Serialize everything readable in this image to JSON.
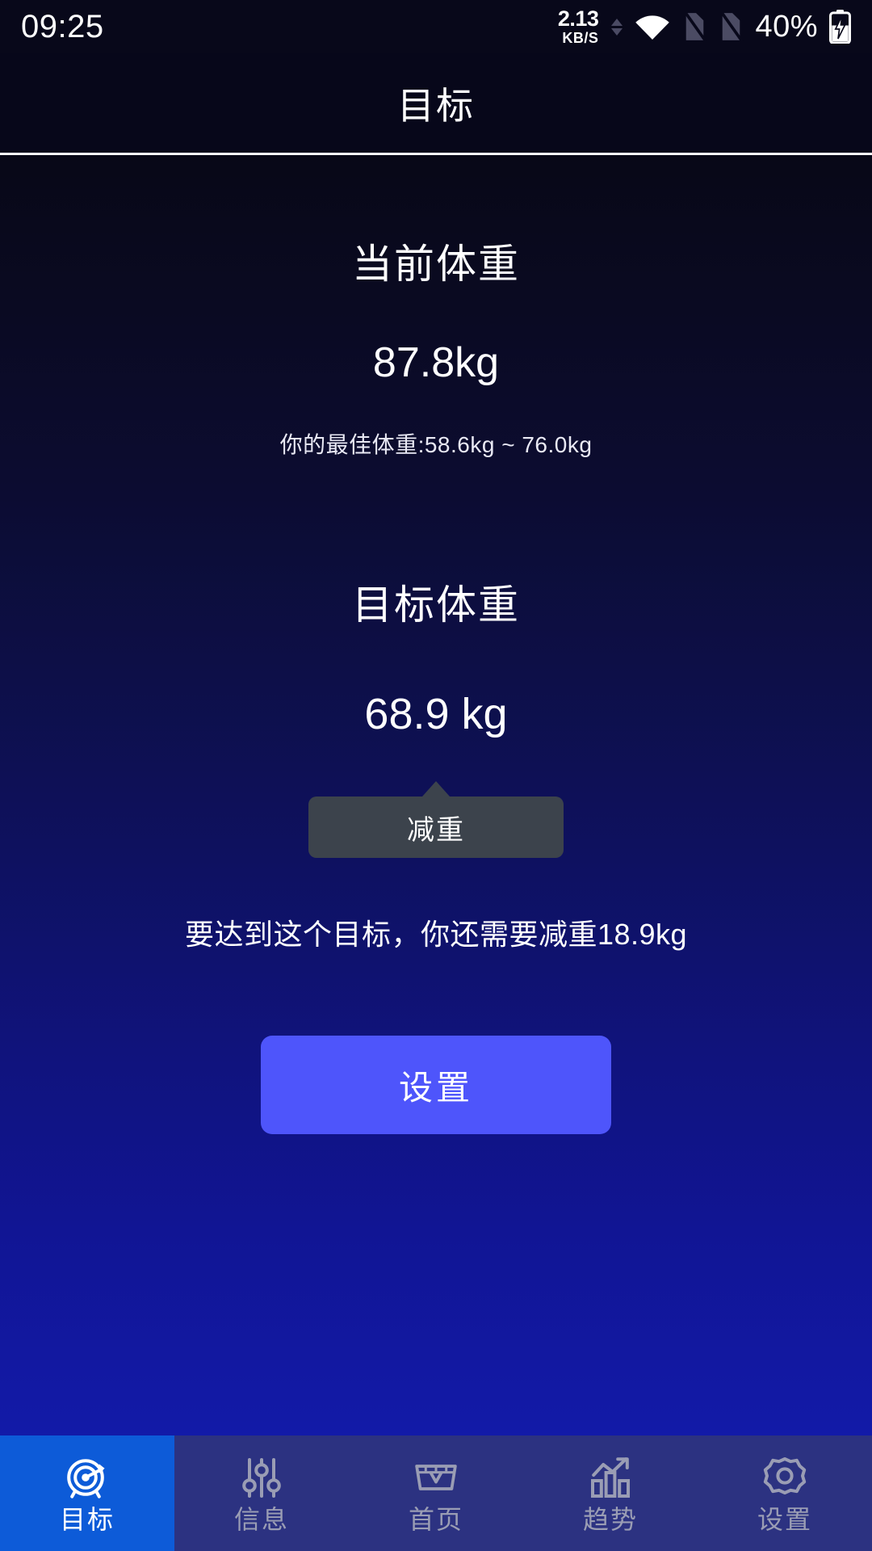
{
  "statusbar": {
    "time": "09:25",
    "netspeed_value": "2.13",
    "netspeed_unit": "KB/S",
    "battery_percent": "40%",
    "icons": {
      "up_arrow": "traffic-up-icon",
      "down_arrow": "traffic-down-icon",
      "wifi": "wifi-icon",
      "sim1": "sim-off-icon",
      "sim2": "sim-off-icon",
      "battery": "battery-charging-icon"
    }
  },
  "header": {
    "title": "目标"
  },
  "main": {
    "current_weight_label": "当前体重",
    "current_weight_value": "87.8kg",
    "ideal_weight_line": "你的最佳体重:58.6kg ~ 76.0kg",
    "target_weight_label": "目标体重",
    "target_weight_value": "68.9 kg",
    "tooltip_label": "减重",
    "goal_description": "要达到这个目标，你还需要减重18.9kg",
    "settings_button_label": "设置"
  },
  "bottomnav": {
    "items": [
      {
        "label": "目标",
        "icon": "target-icon",
        "active": true
      },
      {
        "label": "信息",
        "icon": "sliders-icon",
        "active": false
      },
      {
        "label": "首页",
        "icon": "scale-icon",
        "active": false
      },
      {
        "label": "趋势",
        "icon": "trend-chart-icon",
        "active": false
      },
      {
        "label": "设置",
        "icon": "gear-icon",
        "active": false
      }
    ]
  },
  "colors": {
    "accent_button": "#4e55fb",
    "nav_active": "#0d5bd8",
    "nav_background": "#2c3281",
    "tooltip_background": "#3c434c",
    "background_top": "#080817",
    "background_bottom": "#121aa8"
  }
}
